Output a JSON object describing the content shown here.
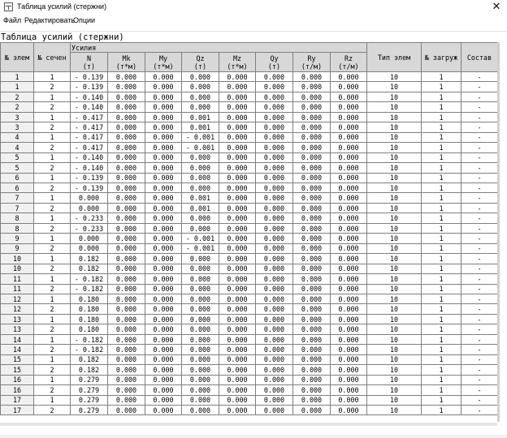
{
  "window": {
    "title": "Таблица усилий (стержни)",
    "close_glyph": "✕",
    "app_icon": "table-app-icon"
  },
  "menu": {
    "items": [
      "Файл",
      "Редактировать",
      "Опции"
    ]
  },
  "panel": {
    "title": "Таблица усилий (стержни)"
  },
  "table": {
    "group_label": "Усилия",
    "columns": [
      {
        "top": "№ элем",
        "bottom": ""
      },
      {
        "top": "№ сечен",
        "bottom": ""
      },
      {
        "top": "N",
        "bottom": "(т)"
      },
      {
        "top": "Mk",
        "bottom": "(т*м)"
      },
      {
        "top": "My",
        "bottom": "(т*м)"
      },
      {
        "top": "Qz",
        "bottom": "(т)"
      },
      {
        "top": "Mz",
        "bottom": "(т*м)"
      },
      {
        "top": "Qy",
        "bottom": "(т)"
      },
      {
        "top": "Ry",
        "bottom": "(т/м)"
      },
      {
        "top": "Rz",
        "bottom": "(т/м)"
      },
      {
        "top": "Тип элем",
        "bottom": ""
      },
      {
        "top": "№ загруж",
        "bottom": ""
      },
      {
        "top": "Состав",
        "bottom": ""
      }
    ],
    "rows": [
      [
        "1",
        "1",
        "- 0.139",
        "0.000",
        "0.000",
        "0.000",
        "0.000",
        "0.000",
        "0.000",
        "0.000",
        "10",
        "1",
        "-"
      ],
      [
        "1",
        "2",
        "- 0.139",
        "0.000",
        "0.000",
        "0.000",
        "0.000",
        "0.000",
        "0.000",
        "0.000",
        "10",
        "1",
        "-"
      ],
      [
        "2",
        "1",
        "- 0.140",
        "0.000",
        "0.000",
        "0.000",
        "0.000",
        "0.000",
        "0.000",
        "0.000",
        "10",
        "1",
        "-"
      ],
      [
        "2",
        "2",
        "- 0.140",
        "0.000",
        "0.000",
        "0.000",
        "0.000",
        "0.000",
        "0.000",
        "0.000",
        "10",
        "1",
        "-"
      ],
      [
        "3",
        "1",
        "- 0.417",
        "0.000",
        "0.000",
        "0.001",
        "0.000",
        "0.000",
        "0.000",
        "0.000",
        "10",
        "1",
        "-"
      ],
      [
        "3",
        "2",
        "- 0.417",
        "0.000",
        "0.000",
        "0.001",
        "0.000",
        "0.000",
        "0.000",
        "0.000",
        "10",
        "1",
        "-"
      ],
      [
        "4",
        "1",
        "- 0.417",
        "0.000",
        "0.000",
        "- 0.001",
        "0.000",
        "0.000",
        "0.000",
        "0.000",
        "10",
        "1",
        "-"
      ],
      [
        "4",
        "2",
        "- 0.417",
        "0.000",
        "0.000",
        "- 0.001",
        "0.000",
        "0.000",
        "0.000",
        "0.000",
        "10",
        "1",
        "-"
      ],
      [
        "5",
        "1",
        "- 0.140",
        "0.000",
        "0.000",
        "0.000",
        "0.000",
        "0.000",
        "0.000",
        "0.000",
        "10",
        "1",
        "-"
      ],
      [
        "5",
        "2",
        "- 0.140",
        "0.000",
        "0.000",
        "0.000",
        "0.000",
        "0.000",
        "0.000",
        "0.000",
        "10",
        "1",
        "-"
      ],
      [
        "6",
        "1",
        "- 0.139",
        "0.000",
        "0.000",
        "0.000",
        "0.000",
        "0.000",
        "0.000",
        "0.000",
        "10",
        "1",
        "-"
      ],
      [
        "6",
        "2",
        "- 0.139",
        "0.000",
        "0.000",
        "0.000",
        "0.000",
        "0.000",
        "0.000",
        "0.000",
        "10",
        "1",
        "-"
      ],
      [
        "7",
        "1",
        "0.000",
        "0.000",
        "0.000",
        "0.001",
        "0.000",
        "0.000",
        "0.000",
        "0.000",
        "10",
        "1",
        "-"
      ],
      [
        "7",
        "2",
        "0.000",
        "0.000",
        "0.000",
        "0.001",
        "0.000",
        "0.000",
        "0.000",
        "0.000",
        "10",
        "1",
        "-"
      ],
      [
        "8",
        "1",
        "- 0.233",
        "0.000",
        "0.000",
        "0.000",
        "0.000",
        "0.000",
        "0.000",
        "0.000",
        "10",
        "1",
        "-"
      ],
      [
        "8",
        "2",
        "- 0.233",
        "0.000",
        "0.000",
        "0.000",
        "0.000",
        "0.000",
        "0.000",
        "0.000",
        "10",
        "1",
        "-"
      ],
      [
        "9",
        "1",
        "0.000",
        "0.000",
        "0.000",
        "- 0.001",
        "0.000",
        "0.000",
        "0.000",
        "0.000",
        "10",
        "1",
        "-"
      ],
      [
        "9",
        "2",
        "0.000",
        "0.000",
        "0.000",
        "- 0.001",
        "0.000",
        "0.000",
        "0.000",
        "0.000",
        "10",
        "1",
        "-"
      ],
      [
        "10",
        "1",
        "0.182",
        "0.000",
        "0.000",
        "0.000",
        "0.000",
        "0.000",
        "0.000",
        "0.000",
        "10",
        "1",
        "-"
      ],
      [
        "10",
        "2",
        "0.182",
        "0.000",
        "0.000",
        "0.000",
        "0.000",
        "0.000",
        "0.000",
        "0.000",
        "10",
        "1",
        "-"
      ],
      [
        "11",
        "1",
        "- 0.182",
        "0.000",
        "0.000",
        "0.000",
        "0.000",
        "0.000",
        "0.000",
        "0.000",
        "10",
        "1",
        "-"
      ],
      [
        "11",
        "2",
        "- 0.182",
        "0.000",
        "0.000",
        "0.000",
        "0.000",
        "0.000",
        "0.000",
        "0.000",
        "10",
        "1",
        "-"
      ],
      [
        "12",
        "1",
        "0.180",
        "0.000",
        "0.000",
        "0.000",
        "0.000",
        "0.000",
        "0.000",
        "0.000",
        "10",
        "1",
        "-"
      ],
      [
        "12",
        "2",
        "0.180",
        "0.000",
        "0.000",
        "0.000",
        "0.000",
        "0.000",
        "0.000",
        "0.000",
        "10",
        "1",
        "-"
      ],
      [
        "13",
        "1",
        "0.180",
        "0.000",
        "0.000",
        "0.000",
        "0.000",
        "0.000",
        "0.000",
        "0.000",
        "10",
        "1",
        "-"
      ],
      [
        "13",
        "2",
        "0.180",
        "0.000",
        "0.000",
        "0.000",
        "0.000",
        "0.000",
        "0.000",
        "0.000",
        "10",
        "1",
        "-"
      ],
      [
        "14",
        "1",
        "- 0.182",
        "0.000",
        "0.000",
        "0.000",
        "0.000",
        "0.000",
        "0.000",
        "0.000",
        "10",
        "1",
        "-"
      ],
      [
        "14",
        "2",
        "- 0.182",
        "0.000",
        "0.000",
        "0.000",
        "0.000",
        "0.000",
        "0.000",
        "0.000",
        "10",
        "1",
        "-"
      ],
      [
        "15",
        "1",
        "0.182",
        "0.000",
        "0.000",
        "0.000",
        "0.000",
        "0.000",
        "0.000",
        "0.000",
        "10",
        "1",
        "-"
      ],
      [
        "15",
        "2",
        "0.182",
        "0.000",
        "0.000",
        "0.000",
        "0.000",
        "0.000",
        "0.000",
        "0.000",
        "10",
        "1",
        "-"
      ],
      [
        "16",
        "1",
        "0.279",
        "0.000",
        "0.000",
        "0.000",
        "0.000",
        "0.000",
        "0.000",
        "0.000",
        "10",
        "1",
        "-"
      ],
      [
        "16",
        "2",
        "0.279",
        "0.000",
        "0.000",
        "0.000",
        "0.000",
        "0.000",
        "0.000",
        "0.000",
        "10",
        "1",
        "-"
      ],
      [
        "17",
        "1",
        "0.279",
        "0.000",
        "0.000",
        "0.000",
        "0.000",
        "0.000",
        "0.000",
        "0.000",
        "10",
        "1",
        "-"
      ],
      [
        "17",
        "2",
        "0.279",
        "0.000",
        "0.000",
        "0.000",
        "0.000",
        "0.000",
        "0.000",
        "0.000",
        "10",
        "1",
        "-"
      ]
    ]
  }
}
